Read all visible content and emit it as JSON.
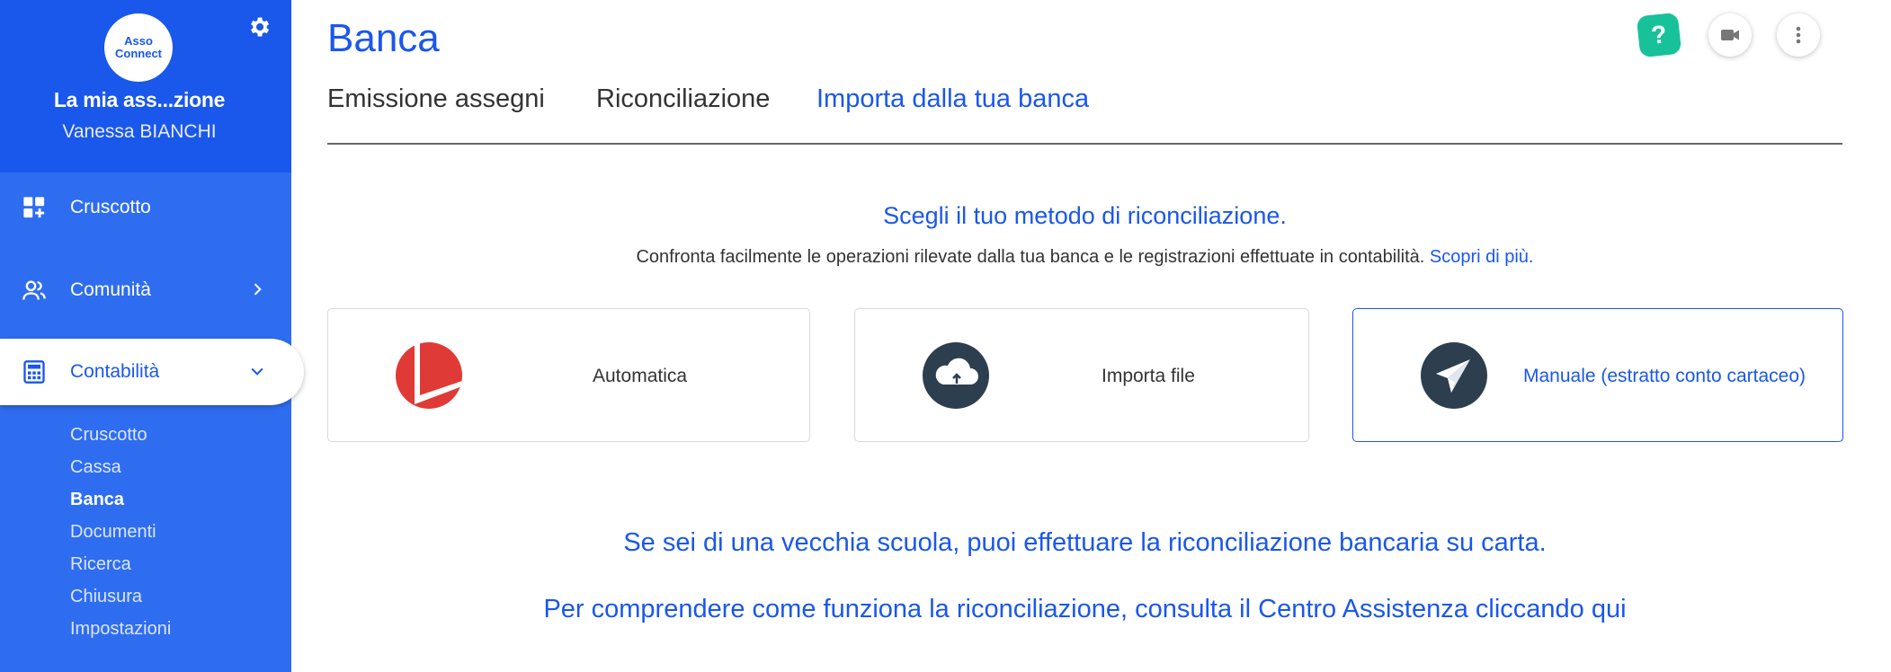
{
  "sidebar": {
    "logo_line1": "Asso",
    "logo_line2": "Connect",
    "org_name": "La mia ass...zione",
    "user_name": "Vanessa BIANCHI",
    "nav": [
      {
        "label": "Cruscotto",
        "icon": "dashboard-icon"
      },
      {
        "label": "Comunità",
        "icon": "people-icon"
      },
      {
        "label": "Contabilità",
        "icon": "calculator-icon"
      }
    ],
    "subnav": [
      "Cruscotto",
      "Cassa",
      "Banca",
      "Documenti",
      "Ricerca",
      "Chiusura",
      "Impostazioni"
    ],
    "current_subnav": "Banca"
  },
  "header": {
    "title": "Banca",
    "help_label": "?"
  },
  "tabs": [
    {
      "label": "Emissione assegni"
    },
    {
      "label": "Riconciliazione"
    },
    {
      "label": "Importa dalla tua banca"
    }
  ],
  "main": {
    "headline": "Scegli il tuo metodo di riconciliazione.",
    "subline": "Confronta facilmente le operazioni rilevate dalla tua banca e le registrazioni effettuate in contabilità.",
    "subline_link": "Scopri di più.",
    "cards": [
      {
        "label": "Automatica",
        "icon": "bank-logo-icon"
      },
      {
        "label": "Importa file",
        "icon": "cloud-upload-icon"
      },
      {
        "label": "Manuale (estratto conto cartaceo)",
        "icon": "paper-plane-icon"
      }
    ],
    "bottom_line1": "Se sei di una vecchia scuola, puoi effettuare la riconciliazione bancaria su carta.",
    "bottom_line2": "Per comprendere come funziona la riconciliazione, consulta il Centro Assistenza cliccando qui"
  },
  "colors": {
    "sidebar_bg": "#2f6df0",
    "sidebar_head_bg": "#1a57eb",
    "accent": "#1a57eb",
    "help_green": "#17c29a",
    "bank_red": "#e03a36",
    "icon_dark": "#2d3e4f"
  }
}
